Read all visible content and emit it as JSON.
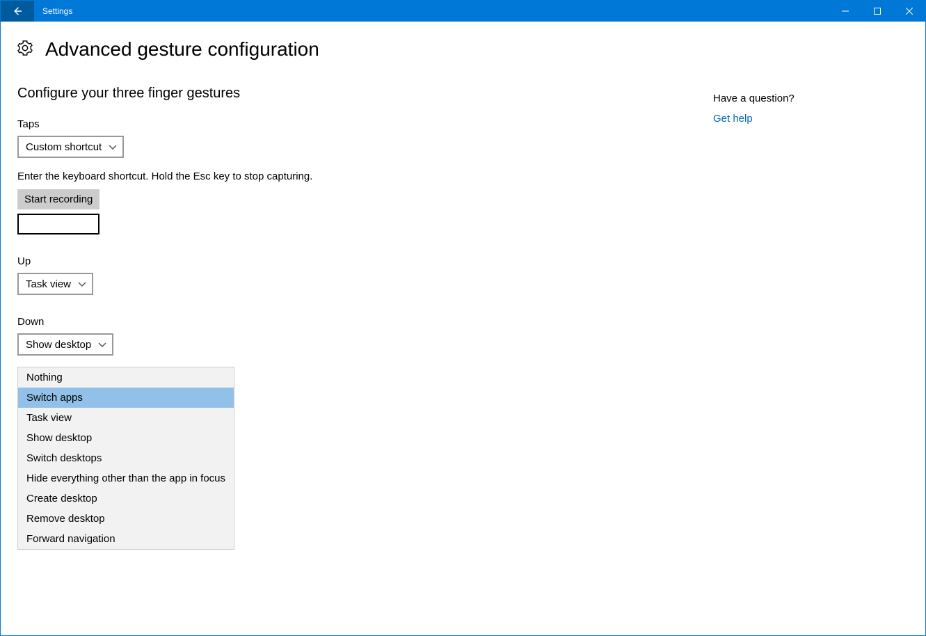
{
  "window": {
    "title": "Settings"
  },
  "page": {
    "title": "Advanced gesture configuration"
  },
  "section": {
    "heading": "Configure your three finger gestures"
  },
  "taps": {
    "label": "Taps",
    "value": "Custom shortcut",
    "hint": "Enter the keyboard shortcut. Hold the Esc key to stop capturing.",
    "record_button": "Start recording",
    "shortcut_value": ""
  },
  "up": {
    "label": "Up",
    "value": "Task view"
  },
  "down": {
    "label": "Down",
    "value": "Show desktop"
  },
  "menu": {
    "selected_index": 1,
    "items": [
      "Nothing",
      "Switch apps",
      "Task view",
      "Show desktop",
      "Switch desktops",
      "Hide everything other than the app in focus",
      "Create desktop",
      "Remove desktop",
      "Forward navigation"
    ]
  },
  "sidebar": {
    "heading": "Have a question?",
    "link": "Get help"
  }
}
